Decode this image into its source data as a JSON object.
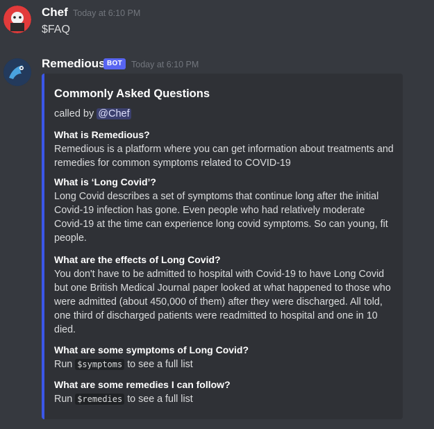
{
  "messages": [
    {
      "author": "Chef",
      "timestamp": "Today at 6:10 PM",
      "content": "$FAQ"
    },
    {
      "author": "Remedious",
      "bot_tag": "BOT",
      "timestamp": "Today at 6:10 PM"
    }
  ],
  "embed": {
    "accent_color": "#3b57e8",
    "title": "Commonly Asked Questions",
    "called_by_prefix": "called by ",
    "called_by_mention": "@Chef",
    "fields": [
      {
        "name": "What is Remedious?",
        "value": "Remedious is a platform where you can get information about treatments and remedies for common symptoms related to COVID-19"
      },
      {
        "name": "What is ‘Long Covid’?",
        "value": "Long Covid describes a set of symptoms that continue long after the initial Covid-19 infection has gone. Even people who had relatively moderate Covid-19 at the time can experience long covid symptoms. So can young, fit people."
      },
      {
        "name": "What are the effects of Long Covid?",
        "value": "You don't have to be admitted to hospital with Covid-19 to have Long Covid but one British Medical Journal paper looked at what happened to those who were admitted (about 450,000 of them) after they were discharged. All told, one third of discharged patients were readmitted to hospital and one in 10 died."
      },
      {
        "name": "What are some symptoms of Long Covid?",
        "value_prefix": "Run ",
        "value_code": "$symptoms",
        "value_suffix": " to see a full list"
      },
      {
        "name": "What are some remedies I can follow?",
        "value_prefix": "Run ",
        "value_code": "$remedies",
        "value_suffix": " to see a full list"
      }
    ]
  },
  "icons": {
    "chef_avatar": "chef-avatar-icon",
    "bot_avatar": "remedious-bot-avatar-icon"
  }
}
